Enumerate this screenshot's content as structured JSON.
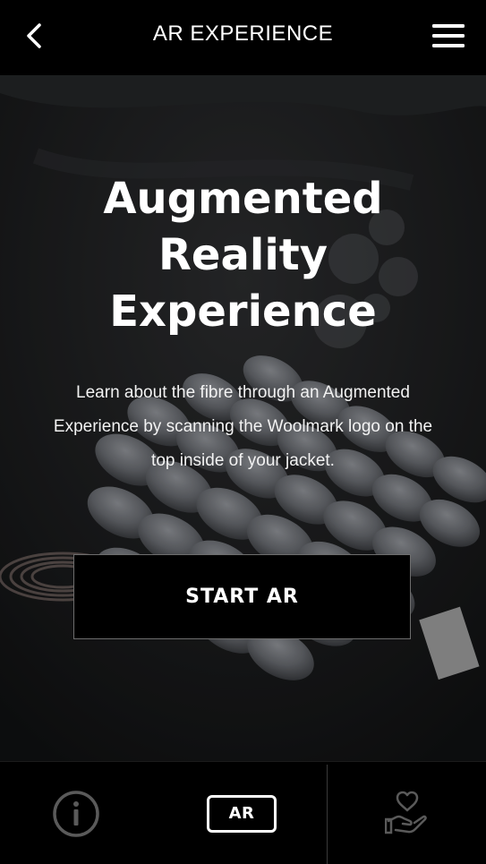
{
  "header": {
    "title": "AR EXPERIENCE",
    "back_icon": "chevron-left-icon",
    "menu_icon": "hamburger-menu-icon"
  },
  "hero": {
    "title": "Augmented Reality Experience",
    "description": "Learn about the fibre through an Augmented Experience by scanning the Woolmark logo on the top inside of your jacket.",
    "cta_label": "START AR",
    "background": "wool-fibre-3d-image"
  },
  "tabbar": {
    "tabs": [
      {
        "icon": "info-icon",
        "label": ""
      },
      {
        "icon": "ar-badge-icon",
        "label": "AR",
        "active": true
      },
      {
        "icon": "heart-in-hand-icon",
        "label": ""
      }
    ]
  },
  "colors": {
    "background": "#000000",
    "text": "#ffffff",
    "inactive_icon": "#5a5a5a",
    "button_border": "#6d6d6d"
  }
}
